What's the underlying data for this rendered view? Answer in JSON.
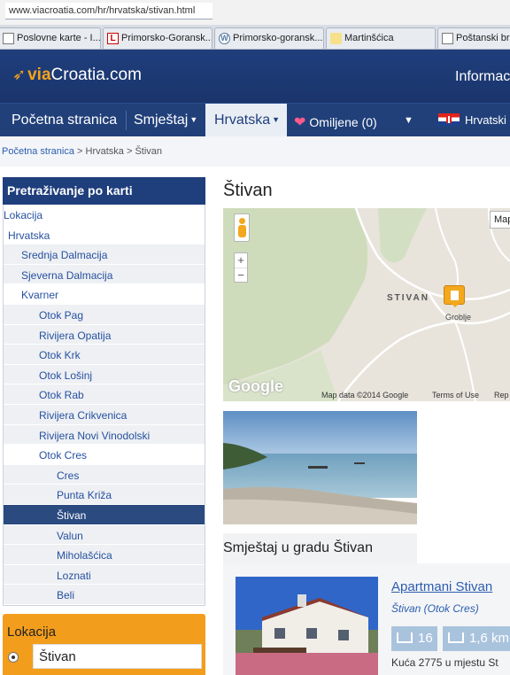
{
  "browser": {
    "url": "www.viacroatia.com/hr/hrvatska/stivan.html",
    "tabs": [
      {
        "label": "Poslovne karte - I...",
        "icon": "page-icon"
      },
      {
        "label": "Primorsko-Goransk...",
        "icon": "letter-l-icon"
      },
      {
        "label": "Primorsko-goransk...",
        "icon": "wordpress-icon"
      },
      {
        "label": "Martinšćica",
        "icon": "photo-icon"
      },
      {
        "label": "Poštanski bro",
        "icon": "page-icon"
      }
    ]
  },
  "header": {
    "logo_via": "via",
    "logo_rest": "Croatia.com",
    "info": "Informaci"
  },
  "nav": {
    "home": "Početna stranica",
    "accommodation": "Smještaj",
    "croatia": "Hrvatska",
    "favorites": "Omiljene (0)",
    "language": "Hrvatski"
  },
  "breadcrumb": {
    "home": "Početna stranica",
    "sep": ">",
    "country": "Hrvatska",
    "current": "Štivan"
  },
  "sidebar": {
    "title": "Pretraživanje po karti",
    "items": [
      {
        "label": "Lokacija",
        "level": 0,
        "style": "plain"
      },
      {
        "label": "Hrvatska",
        "level": 1,
        "style": "plain"
      },
      {
        "label": "Srednja Dalmacija",
        "level": 2,
        "style": "bg"
      },
      {
        "label": "Sjeverna Dalmacija",
        "level": 2,
        "style": "bg"
      },
      {
        "label": "Kvarner",
        "level": 2,
        "style": "plain"
      },
      {
        "label": "Otok Pag",
        "level": 3,
        "style": "bg"
      },
      {
        "label": "Rivijera Opatija",
        "level": 3,
        "style": "bg"
      },
      {
        "label": "Otok Krk",
        "level": 3,
        "style": "bg"
      },
      {
        "label": "Otok Lošinj",
        "level": 3,
        "style": "bg"
      },
      {
        "label": "Otok Rab",
        "level": 3,
        "style": "bg"
      },
      {
        "label": "Rivijera Crikvenica",
        "level": 3,
        "style": "bg"
      },
      {
        "label": "Rivijera Novi Vinodolski",
        "level": 3,
        "style": "bg"
      },
      {
        "label": "Otok Cres",
        "level": 3,
        "style": "plain"
      },
      {
        "label": "Cres",
        "level": 4,
        "style": "bg"
      },
      {
        "label": "Punta Križa",
        "level": 4,
        "style": "bg"
      },
      {
        "label": "Štivan",
        "level": 4,
        "style": "selected"
      },
      {
        "label": "Valun",
        "level": 4,
        "style": "bg"
      },
      {
        "label": "Miholašćica",
        "level": 4,
        "style": "bg"
      },
      {
        "label": "Loznati",
        "level": 4,
        "style": "bg"
      },
      {
        "label": "Beli",
        "level": 4,
        "style": "bg"
      }
    ],
    "location_box": {
      "label": "Lokacija",
      "value": "Štivan"
    }
  },
  "content": {
    "title": "Štivan",
    "map": {
      "place_label": "STIVAN",
      "cemetery_label": "Groblje",
      "type_button": "Map",
      "zoom_in": "+",
      "zoom_out": "−",
      "brand": "Google",
      "data_credit": "Map data ©2014 Google",
      "terms": "Terms of Use",
      "report": "Rep"
    },
    "accommodation_heading": "Smještaj u gradu Štivan",
    "listing": {
      "title": "Apartmani Stivan",
      "location": "Štivan (Otok Cres)",
      "beds": "16",
      "distance": "1,6 km",
      "description": "Kuća 2775 u mjestu St"
    }
  },
  "colors": {
    "header_blue": "#1f3e7c",
    "accent_orange": "#f39d1d",
    "link_blue": "#2a5db0",
    "selected_item": "#2a4a80"
  }
}
